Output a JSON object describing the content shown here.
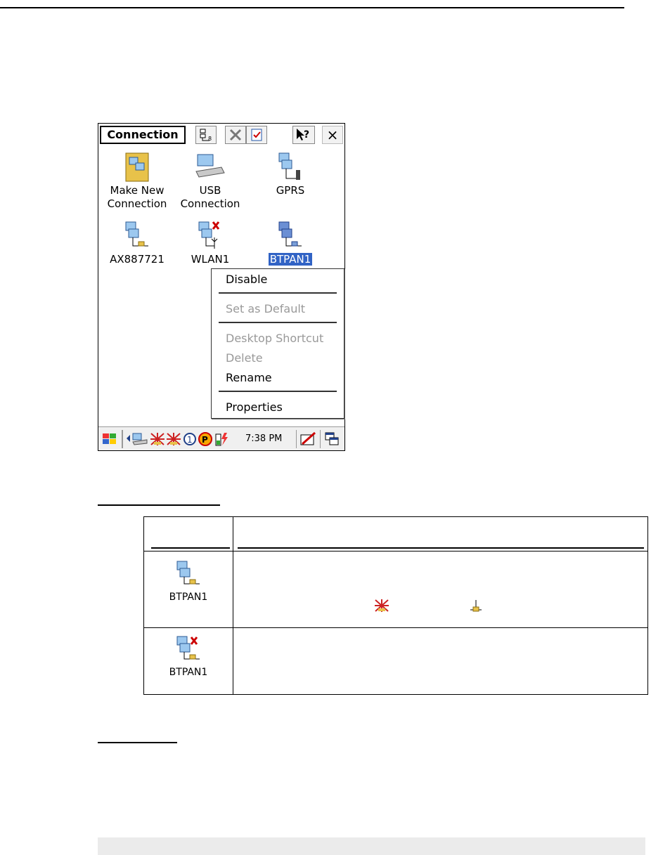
{
  "device": {
    "toolbar": {
      "title": "Connection",
      "close": "×"
    },
    "icons": [
      {
        "label": "Make New\nConnection",
        "icon": "make-new-connection-icon"
      },
      {
        "label": "USB\nConnection",
        "icon": "usb-connection-icon"
      },
      {
        "label": "GPRS",
        "icon": "gprs-connection-icon"
      },
      {
        "label": "AX887721",
        "icon": "lan-connection-icon"
      },
      {
        "label": "WLAN1",
        "icon": "wlan-disconnected-icon"
      },
      {
        "label": "BTPAN1",
        "icon": "btpan-connection-icon"
      }
    ],
    "context_menu": {
      "items": [
        {
          "label": "Disable",
          "enabled": true
        },
        {
          "label": "Set as Default",
          "enabled": false
        },
        {
          "label": "Desktop Shortcut",
          "enabled": false
        },
        {
          "label": "Delete",
          "enabled": false
        },
        {
          "label": "Rename",
          "enabled": true
        },
        {
          "label": "Properties",
          "enabled": true
        }
      ]
    },
    "taskbar": {
      "time": "7:38 PM"
    }
  },
  "table": {
    "rows": [
      {
        "label": "BTPAN1",
        "icon": "btpan-connected-icon"
      },
      {
        "label": "BTPAN1",
        "icon": "btpan-disconnected-icon"
      }
    ]
  },
  "colors": {
    "selection": "#3163c5",
    "disabled_text": "#999999",
    "gray_bar": "#ebebeb"
  }
}
